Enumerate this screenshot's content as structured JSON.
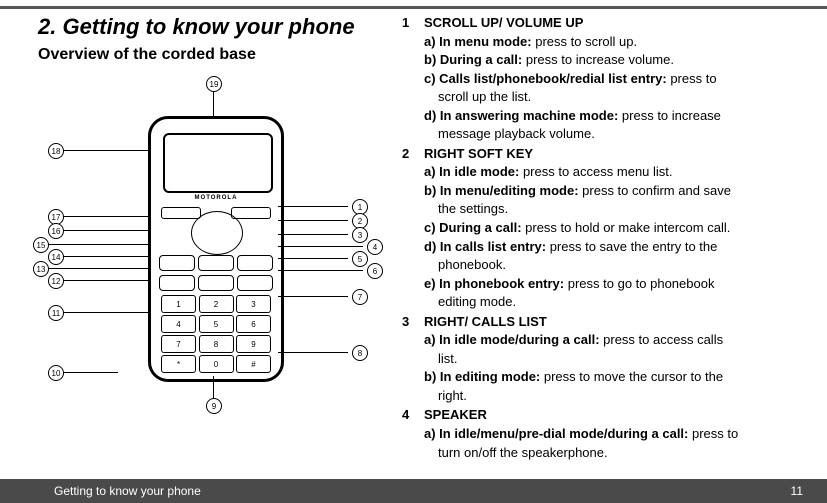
{
  "header": {
    "title": "2. Getting to know your phone",
    "subtitle": "Overview of the corded base"
  },
  "device": {
    "brand": "MOTOROLA"
  },
  "callouts": {
    "top": "19",
    "right": [
      "1",
      "2",
      "3",
      "4",
      "5",
      "6",
      "7",
      "8"
    ],
    "left": [
      "18",
      "17",
      "16",
      "15",
      "14",
      "13",
      "12",
      "11",
      "10"
    ],
    "bottom": "9"
  },
  "items": [
    {
      "num": "1",
      "title": "SCROLL UP/ VOLUME UP",
      "subs": [
        {
          "b": "a) In menu mode:",
          "t": " press to scroll up."
        },
        {
          "b": "b) During a call:",
          "t": " press to increase volume."
        },
        {
          "b": "c) Calls list/phonebook/redial list entry:",
          "t": " press to",
          "cont": "scroll up the list."
        },
        {
          "b": "d) In answering machine mode:",
          "t": " press to increase",
          "cont": "message playback volume."
        }
      ]
    },
    {
      "num": "2",
      "title": "RIGHT SOFT KEY",
      "subs": [
        {
          "b": "a) In idle mode:",
          "t": " press to access menu list."
        },
        {
          "b": "b) In menu/editing mode:",
          "t": " press to confirm and save",
          "cont": "the settings."
        },
        {
          "b": "c) During a call:",
          "t": " press to hold or make intercom call."
        },
        {
          "b": "d) In calls list entry:",
          "t": " press to save the entry to the",
          "cont": "phonebook."
        },
        {
          "b": "e) In phonebook entry:",
          "t": " press to go to phonebook",
          "cont": "editing mode."
        }
      ]
    },
    {
      "num": "3",
      "title": "RIGHT/ CALLS LIST",
      "subs": [
        {
          "b": "a) In idle mode/during a call:",
          "t": " press to access calls",
          "cont": "list."
        },
        {
          "b": "b) In editing mode:",
          "t": " press to move the cursor to the",
          "cont": "right."
        }
      ]
    },
    {
      "num": "4",
      "title": "SPEAKER",
      "subs": [
        {
          "b": "a) In idle/menu/pre-dial mode/during a call:",
          "t": " press to",
          "cont": "turn on/off the speakerphone."
        }
      ]
    }
  ],
  "footer": {
    "section": "Getting to know your phone",
    "page": "11"
  }
}
